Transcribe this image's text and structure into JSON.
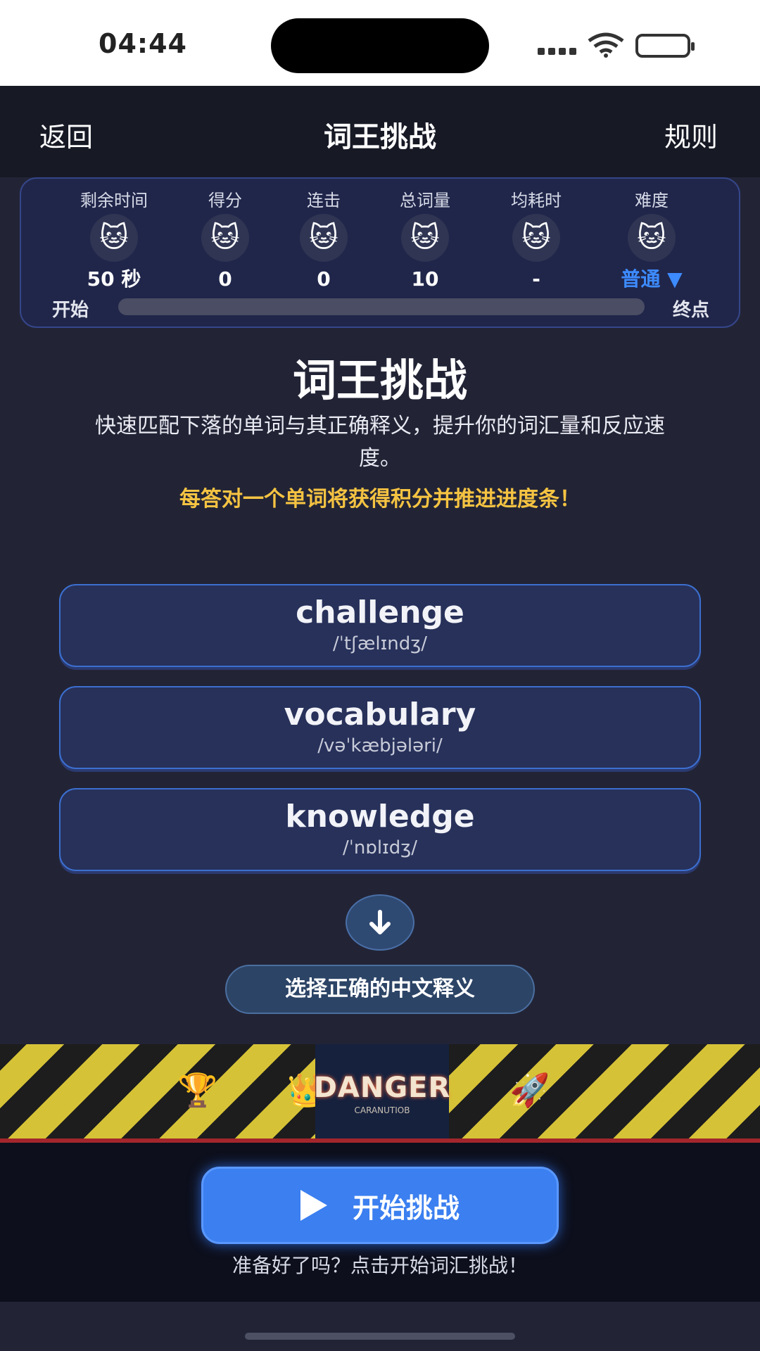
{
  "status_bar": {
    "time": "04:44"
  },
  "nav": {
    "back": "返回",
    "title": "词王挑战",
    "rules": "规则"
  },
  "stats": [
    {
      "label": "剩余时间",
      "icon": "cat-gray",
      "glyph": "🐱",
      "value": "50 秒"
    },
    {
      "label": "得分",
      "icon": "cat-cream",
      "glyph": "🐱",
      "value": "0"
    },
    {
      "label": "连击",
      "icon": "cat-orange",
      "glyph": "🐱",
      "value": "0"
    },
    {
      "label": "总词量",
      "icon": "cat-tabby",
      "glyph": "🐱",
      "value": "10"
    },
    {
      "label": "均耗时",
      "icon": "cat-calico",
      "glyph": "🐱",
      "value": "-"
    },
    {
      "label": "难度",
      "icon": "cat-white",
      "glyph": "🐱",
      "value": "普通 ▼"
    }
  ],
  "progress": {
    "start_label": "开始",
    "end_label": "终点",
    "percent": 0
  },
  "hero": {
    "title": "词王挑战",
    "description": "快速匹配下落的单词与其正确释义，提升你的词汇量和反应速度。",
    "hint": "每答对一个单词将获得积分并推进进度条！"
  },
  "words": [
    {
      "word": "challenge",
      "phonetic": "/ˈtʃælɪndʒ/"
    },
    {
      "word": "vocabulary",
      "phonetic": "/vəˈkæbjələri/"
    },
    {
      "word": "knowledge",
      "phonetic": "/ˈnɒlɪdʒ/"
    }
  ],
  "select_prompt": "选择正确的中文释义",
  "banner": {
    "main_text": "DANGER",
    "sub_text": "CARANUTIOB",
    "icons": [
      "trophy-icon",
      "crown-icon",
      "rocket-icon"
    ]
  },
  "start_button": {
    "label": "开始挑战"
  },
  "bottom_hint": "准备好了吗？点击开始词汇挑战！",
  "colors": {
    "accent": "#3b7ff0",
    "hint_yellow": "#f5c342",
    "background": "#222436"
  }
}
